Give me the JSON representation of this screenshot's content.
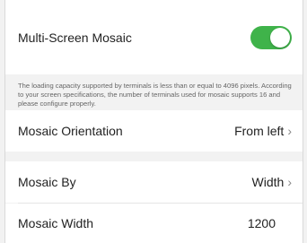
{
  "mosaic": {
    "title": "Multi-Screen Mosaic",
    "enabled": true,
    "note": "The loading capacity supported by terminals is less than or equal to 4096 pixels. According to your screen specifications, the number of terminals used for mosaic supports 16 and please configure properly."
  },
  "orientation": {
    "label": "Mosaic Orientation",
    "value": "From left"
  },
  "by": {
    "label": "Mosaic By",
    "value": "Width"
  },
  "width": {
    "label": "Mosaic Width",
    "value": "1200"
  },
  "colors": {
    "toggle_on": "#3fb34a",
    "background": "#f2f2f2"
  },
  "icons": {
    "chevron": "chevron-right-icon"
  }
}
